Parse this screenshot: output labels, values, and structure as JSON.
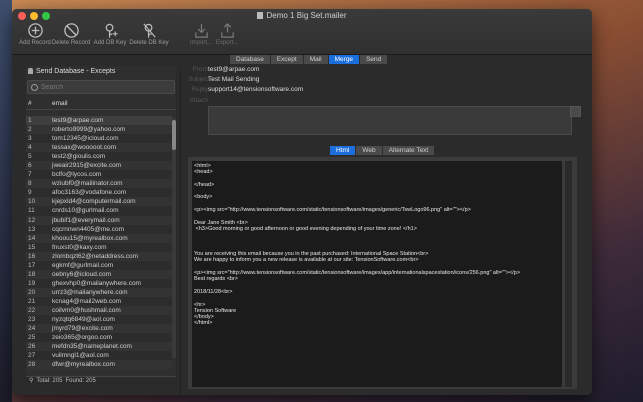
{
  "window": {
    "title": "Demo 1 Big Set.mailer"
  },
  "toolbar": [
    {
      "label": "Add Record",
      "icon": "plus-circle-icon",
      "enabled": true
    },
    {
      "label": "Delete Record",
      "icon": "no-sign-icon",
      "enabled": true
    },
    {
      "label": "Add DB Key",
      "icon": "add-key-icon",
      "enabled": true
    },
    {
      "label": "Delete DB Key",
      "icon": "delete-key-icon",
      "enabled": true
    },
    {
      "label": "Import...",
      "icon": "import-icon",
      "enabled": false
    },
    {
      "label": "Export...",
      "icon": "export-icon",
      "enabled": false
    }
  ],
  "tabs": [
    "Database",
    "Except",
    "Mail",
    "Merge",
    "Send"
  ],
  "active_tab": "Merge",
  "sidebar": {
    "title": "Send Database - Excepts",
    "search_placeholder": "Search",
    "col_num": "#",
    "col_email": "email",
    "rows": [
      {
        "n": "1",
        "email": "test9@arpae.com"
      },
      {
        "n": "2",
        "email": "roberto9999@yahoo.com"
      },
      {
        "n": "3",
        "email": "tom12345@icloud.com"
      },
      {
        "n": "4",
        "email": "tessax@wooooot.com"
      },
      {
        "n": "5",
        "email": "test2@gioulis.com"
      },
      {
        "n": "6",
        "email": "jweair2915@excite.com"
      },
      {
        "n": "7",
        "email": "bclfo@lycos.com"
      },
      {
        "n": "8",
        "email": "wziubf0@mailinator.com"
      },
      {
        "n": "9",
        "email": "afoc3163@vodafone.com"
      },
      {
        "n": "10",
        "email": "kjepxld4@computermail.com"
      },
      {
        "n": "11",
        "email": "cnrds10@gurlmail.com"
      },
      {
        "n": "12",
        "email": "jbubif1@everymail.com"
      },
      {
        "n": "13",
        "email": "cqcrnnwn4405@me.com"
      },
      {
        "n": "14",
        "email": "khoou15@myrealbox.com"
      },
      {
        "n": "15",
        "email": "fnuxst0@kaxy.com"
      },
      {
        "n": "16",
        "email": "zlombqzt62@netaddress.com"
      },
      {
        "n": "17",
        "email": "egkmf@gurlmail.com"
      },
      {
        "n": "18",
        "email": "oebny6@icloud.com"
      },
      {
        "n": "19",
        "email": "ghexvhp0@mailanywhere.com"
      },
      {
        "n": "20",
        "email": "urrz3@mailanywhere.com"
      },
      {
        "n": "21",
        "email": "kcnag4@mail2web.com"
      },
      {
        "n": "22",
        "email": "coilvm0@hushmail.com"
      },
      {
        "n": "23",
        "email": "nyzqtq6849@aol.com"
      },
      {
        "n": "24",
        "email": "jmyrd79@excite.com"
      },
      {
        "n": "25",
        "email": "zeio365@orgoo.com"
      },
      {
        "n": "26",
        "email": "mefdn35@nameplanet.com"
      },
      {
        "n": "27",
        "email": "vuilmngl1@aol.com"
      },
      {
        "n": "28",
        "email": "dfwr@myrealbox.com"
      }
    ],
    "footer_total": "Total: 205",
    "footer_found": "Found: 205"
  },
  "mail": {
    "from_label": "From",
    "from": "test9@arpae.com",
    "subject_label": "Subject",
    "subject": "Test Mail Sending",
    "reply_label": "Reply",
    "reply": "support14@tensionsoftware.com",
    "attach_label": "Attach"
  },
  "body_tabs": [
    "Html",
    "Web",
    "Alternate Text"
  ],
  "body_active": "Html",
  "html_source": "<html>\n<head>\n\n</head>\n\n<body>\n\n<p><img src=\"http://www.tensionsoftware.com/static/tensionsoftware/images/generic/TswLogo96.png\" alt=\"\"></p>\n\nDear Jane Smith <br>\n <h3>Good morning or good afternoon or good evening depending of your time zone! </h1>\n\n\n\nYou are receiving this email because you in the past purchased: International Space Station<br>\nWe are happy to inform you a new release is available at our site: TensionSoftware.com<br>\n\n<p><img src=\"http://www.tensionsoftware.com/static/tensionsoftware/images/app/internationalspacestation/icons/256.png\" alt=\"\"></p>\nBest regards <br>\n\n2018/11/28<br>\n\n<hr>\nTension Software\n</body>\n</html>"
}
